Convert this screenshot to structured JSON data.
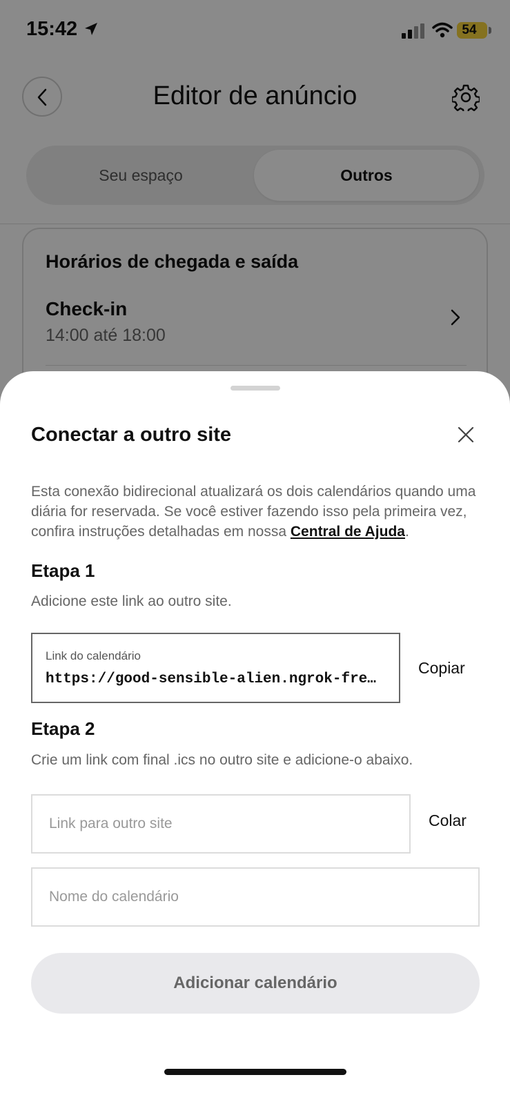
{
  "status_bar": {
    "time": "15:42",
    "battery": "54"
  },
  "header": {
    "title": "Editor de anúncio"
  },
  "segmented": {
    "left": "Seu espaço",
    "right": "Outros"
  },
  "card": {
    "title": "Horários de chegada e saída",
    "checkin_label": "Check-in",
    "checkin_value": "14:00 até 18:00"
  },
  "sheet": {
    "title": "Conectar a outro site",
    "description": "Esta conexão bidirecional atualizará os dois calendários quando uma diária for reservada. Se você estiver fazendo isso pela primeira vez, confira instruções detalhadas em nossa ",
    "help_link": "Central de Ajuda",
    "description_end": ".",
    "step1": {
      "title": "Etapa 1",
      "desc": "Adicione este link ao outro site.",
      "link_label": "Link do calendário",
      "link_value": "https://good-sensible-alien.ngrok-free.app/…",
      "copy": "Copiar"
    },
    "step2": {
      "title": "Etapa 2",
      "desc": "Crie um link com final .ics no outro site e adicione-o abaixo.",
      "link_placeholder": "Link para outro site",
      "paste": "Colar",
      "name_placeholder": "Nome do calendário"
    },
    "add_button": "Adicionar calendário"
  },
  "colors": {
    "battery": "#f5d33b",
    "overlay": "rgba(0,0,0,0.46)"
  }
}
